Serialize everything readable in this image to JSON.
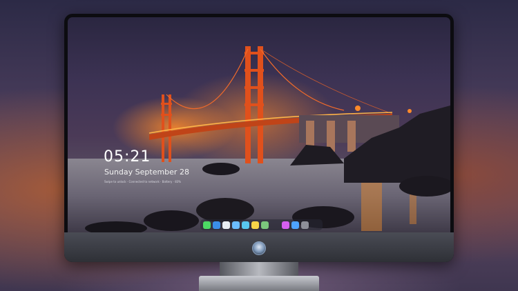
{
  "lockscreen": {
    "time": "05:21",
    "date": "Sunday September  28",
    "status_line": "Swipe to unlock · Connected to network · Battery · 83%"
  },
  "dock": {
    "apps": [
      {
        "icon": "messages-icon",
        "color": "#4cd964"
      },
      {
        "icon": "finder-icon",
        "color": "#3b8ee8"
      },
      {
        "icon": "safari-icon",
        "color": "#e8edf2"
      },
      {
        "icon": "calendar-icon",
        "color": "#6bbcff"
      },
      {
        "icon": "clapper-icon",
        "color": "#58c8f0"
      },
      {
        "icon": "notes-icon",
        "color": "#f7d548"
      },
      {
        "icon": "photos-icon",
        "color": "#7bc67c"
      },
      {
        "icon": "music-icon",
        "color": "#d65ff0"
      },
      {
        "icon": "app-store-icon",
        "color": "#4da3ff"
      },
      {
        "icon": "camera-icon",
        "color": "#8d8f99"
      }
    ]
  },
  "colors": {
    "bridge": "#e0501c",
    "lights": "#ffb347",
    "sky": "#3d3354"
  }
}
